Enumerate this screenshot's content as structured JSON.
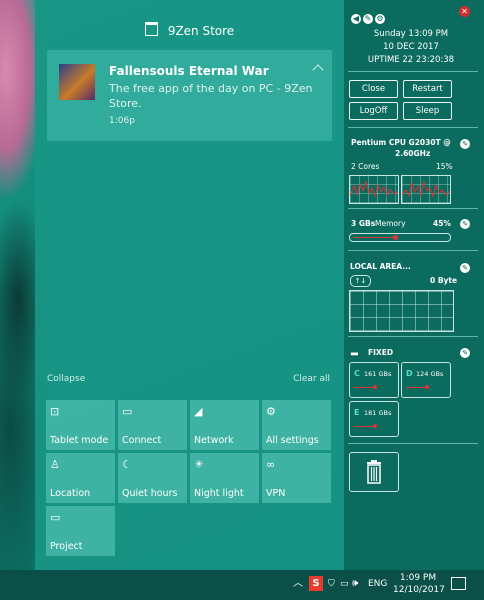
{
  "action_center": {
    "notification_group": "9Zen Store",
    "notification": {
      "title": "Fallensouls Eternal War",
      "body": "The free app of the day on PC - 9Zen Store.",
      "time": "1:06p"
    },
    "collapse_label": "Collapse",
    "clear_all_label": "Clear all",
    "tiles": [
      {
        "icon": "tablet-mode-icon",
        "glyph": "⊡",
        "label": "Tablet mode"
      },
      {
        "icon": "connect-icon",
        "glyph": "▭",
        "label": "Connect"
      },
      {
        "icon": "network-icon",
        "glyph": "◢",
        "label": "Network"
      },
      {
        "icon": "settings-icon",
        "glyph": "⚙",
        "label": "All settings"
      },
      {
        "icon": "location-icon",
        "glyph": "♙",
        "label": "Location"
      },
      {
        "icon": "quiet-hours-icon",
        "glyph": "☾",
        "label": "Quiet hours"
      },
      {
        "icon": "night-light-icon",
        "glyph": "☀",
        "label": "Night light"
      },
      {
        "icon": "vpn-icon",
        "glyph": "∞",
        "label": "VPN"
      },
      {
        "icon": "project-icon",
        "glyph": "▭",
        "label": "Project"
      }
    ]
  },
  "gadget": {
    "day_time": "Sunday 13:09 PM",
    "date": "10 DEC 2017",
    "uptime": "UPTIME 22 23:20:38",
    "buttons": [
      "Close",
      "Restart",
      "LogOff",
      "Sleep"
    ],
    "cpu": {
      "name_line1": "Pentium CPU G2030T @",
      "name_line2": "2.60GHz",
      "cores": "2 Cores",
      "usage": "15%"
    },
    "memory": {
      "size": "3 GBs",
      "label": "Memory",
      "usage": "45%",
      "usage_fraction": 0.45
    },
    "network": {
      "name": "LOCAL AREA...",
      "updown": "↑↓",
      "rate": "0 Byte"
    },
    "drives": {
      "title": "FIXED",
      "items": [
        {
          "letter": "C",
          "size": "161 GBs"
        },
        {
          "letter": "D",
          "size": "124 GBs"
        },
        {
          "letter": "E",
          "size": "181 GBs"
        }
      ]
    }
  },
  "taskbar": {
    "chevron": "︿",
    "language": "ENG",
    "time": "1:09 PM",
    "date": "12/10/2017"
  }
}
